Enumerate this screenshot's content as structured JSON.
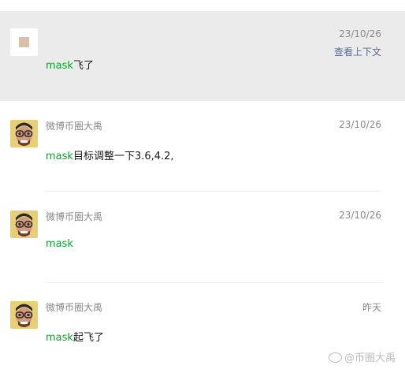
{
  "messages": [
    {
      "sender": "",
      "time": "23/10/26",
      "keyword": "mask",
      "rest": "飞了",
      "context_link": "查看上下文",
      "avatar": "blank-avatar"
    },
    {
      "sender": "微博币圈大禹",
      "time": "23/10/26",
      "keyword": "mask",
      "rest": "目标调整一下3.6,4.2,",
      "avatar": "cartoon-face-avatar"
    },
    {
      "sender": "微博币圈大禹",
      "time": "23/10/26",
      "keyword": "mask",
      "rest": "",
      "avatar": "cartoon-face-avatar"
    },
    {
      "sender": "微博币圈大禹",
      "time": "昨天",
      "keyword": "mask",
      "rest": "起飞了",
      "avatar": "cartoon-face-avatar"
    }
  ],
  "watermark": "@币圈大禹",
  "colors": {
    "keyword": "#07a52a",
    "link": "#576b95",
    "meta": "#888888",
    "highlight_bg": "#ebebeb"
  }
}
